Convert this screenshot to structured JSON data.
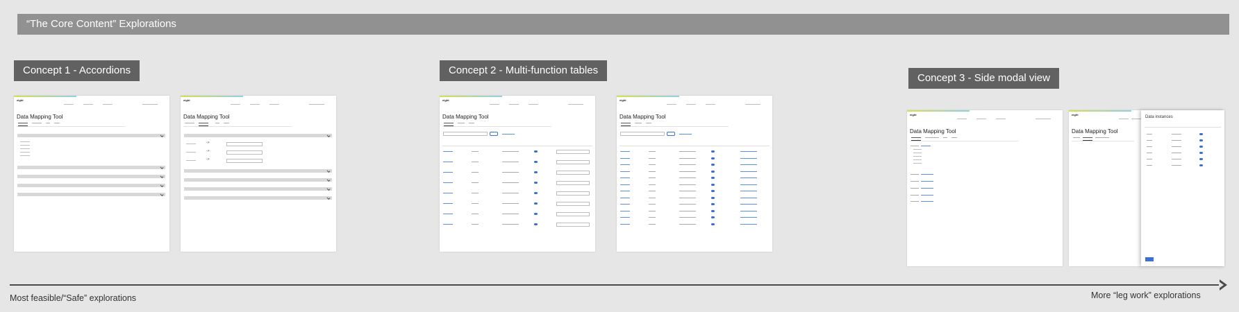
{
  "banner": {
    "title": "“The Core Content” Explorations"
  },
  "concepts": [
    {
      "label": "Concept 1 - Accordions"
    },
    {
      "label": "Concept 2 - Multi-function tables"
    },
    {
      "label": "Concept 3 - Side modal view"
    }
  ],
  "mockup": {
    "app_title": "Data Mapping Tool",
    "modal_title": "Data instances"
  },
  "axis": {
    "left_label": "Most feasible/“Safe” explorations",
    "right_label": "More “leg work” explorations"
  },
  "colors": {
    "background": "#e6e6e6",
    "banner": "#919191",
    "concept_label": "#616161",
    "accent_blue": "#3a6fd8"
  }
}
